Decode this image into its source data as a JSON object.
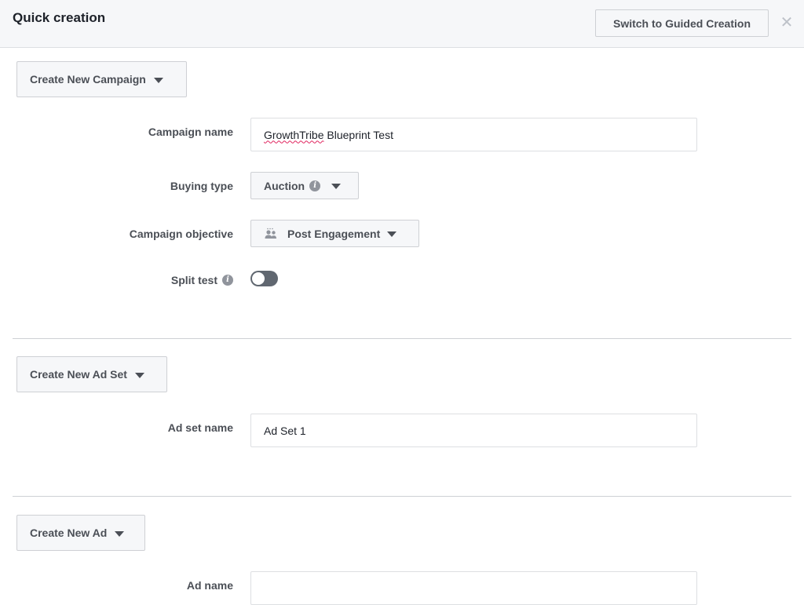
{
  "header": {
    "title": "Quick creation",
    "switch_label": "Switch to Guided Creation",
    "close_glyph": "✕"
  },
  "campaign": {
    "section_label": "Create New Campaign",
    "name_label": "Campaign name",
    "name_value_part1": "GrowthTribe",
    "name_value_part2": " Blueprint Test",
    "buying_type_label": "Buying type",
    "buying_type_value": "Auction",
    "objective_label": "Campaign objective",
    "objective_value": "Post Engagement",
    "split_test_label": "Split test",
    "split_test_on": false
  },
  "ad_set": {
    "section_label": "Create New Ad Set",
    "name_label": "Ad set name",
    "name_value": "Ad Set 1"
  },
  "ad": {
    "section_label": "Create New Ad",
    "name_label": "Ad name"
  },
  "icons": {
    "info": "info-icon",
    "caret": "caret-down-icon",
    "objective": "people-icon",
    "close": "close-icon"
  },
  "colors": {
    "header_bg": "#f6f7f9",
    "text": "#4b4f56",
    "toggle_off": "#606770",
    "spellcheck": "#e0245e"
  }
}
